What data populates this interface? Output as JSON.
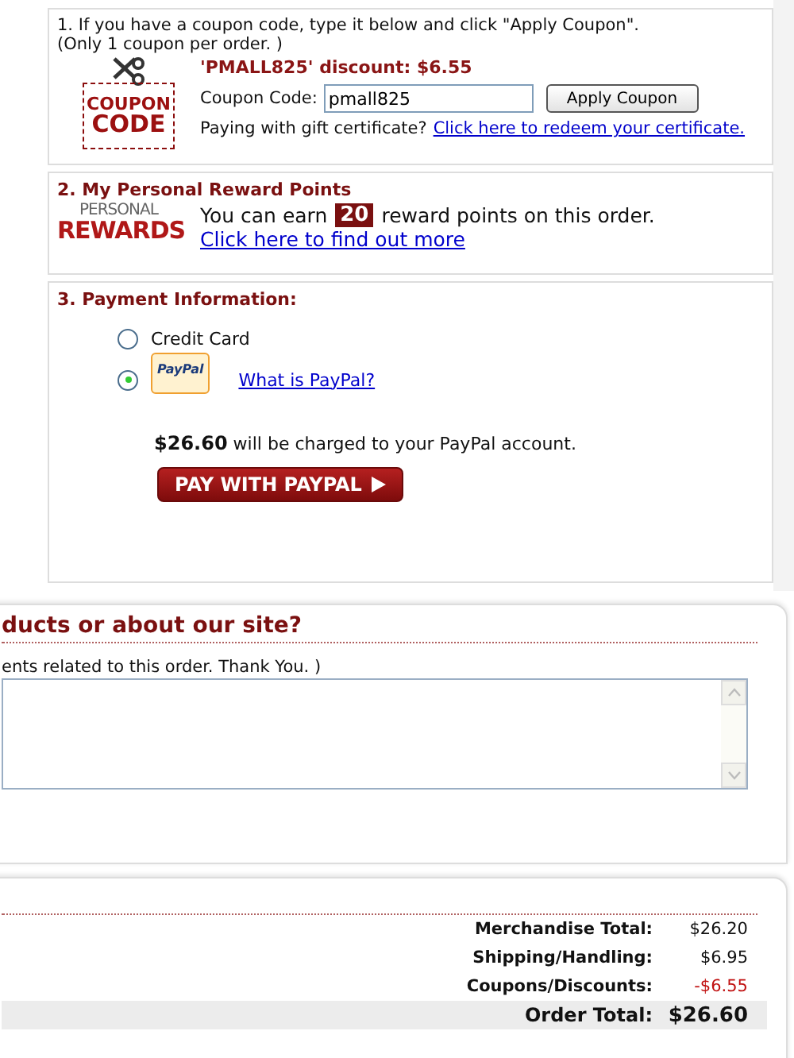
{
  "coupon": {
    "instruction": "1. If you have a coupon code, type it below and click \"Apply Coupon\".",
    "note": "(Only 1 coupon per order. )",
    "badge_top": "COUPON",
    "badge_bottom": "CODE",
    "discount_message": "'PMALL825' discount: $6.55",
    "code_label": "Coupon Code:",
    "code_value": "pmall825",
    "apply_button": "Apply Coupon",
    "gift_prompt": "Paying with gift certificate?",
    "gift_link": "Click here to redeem your certificate."
  },
  "rewards": {
    "title": "2. My Personal Reward Points",
    "logo_top": "PERSONAL",
    "logo_bottom": "REWARDS",
    "text_before": "You can earn",
    "points": "20",
    "text_after": "reward points on this order.",
    "link": "Click here to find out more"
  },
  "payment": {
    "title": "3. Payment Information:",
    "options": [
      {
        "kind": "text",
        "label": "Credit Card",
        "selected": false
      },
      {
        "kind": "paypal",
        "badge": "PayPal",
        "link": "What is PayPal?",
        "selected": true
      }
    ],
    "amount": "$26.60",
    "charge_text": "will be charged to your PayPal account.",
    "pay_button": "PAY WITH PAYPAL"
  },
  "comments": {
    "title": "ducts or about our site?",
    "hint": "ents related to this order. Thank You. )"
  },
  "totals": [
    {
      "kind": "normal",
      "label": "Merchandise Total:",
      "value": "$26.20"
    },
    {
      "kind": "normal",
      "label": "Shipping/Handling:",
      "value": "$6.95"
    },
    {
      "kind": "discount",
      "label": "Coupons/Discounts:",
      "value": "-$6.55"
    },
    {
      "kind": "total",
      "label": "Order Total:",
      "value": "$26.60"
    }
  ]
}
